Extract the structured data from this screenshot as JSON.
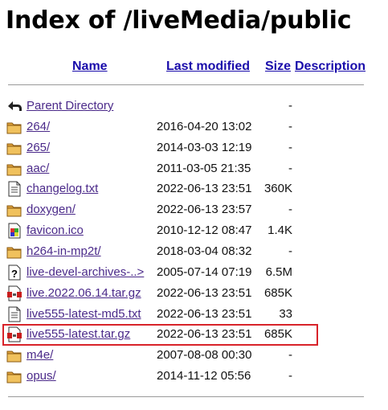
{
  "page": {
    "title": "Index of /liveMedia/public"
  },
  "columns": {
    "name": "Name",
    "last_modified": "Last modified",
    "size": "Size",
    "description": "Description"
  },
  "rows": [
    {
      "name": "Parent Directory",
      "date": "",
      "size": "-",
      "icon": "parent-directory-icon"
    },
    {
      "name": "264/",
      "date": "2016-04-20 13:02",
      "size": "-",
      "icon": "folder-icon"
    },
    {
      "name": "265/",
      "date": "2014-03-03 12:19",
      "size": "-",
      "icon": "folder-icon"
    },
    {
      "name": "aac/",
      "date": "2011-03-05 21:35",
      "size": "-",
      "icon": "folder-icon"
    },
    {
      "name": "changelog.txt",
      "date": "2022-06-13 23:51",
      "size": "360K",
      "icon": "text-file-icon"
    },
    {
      "name": "doxygen/",
      "date": "2022-06-13 23:57",
      "size": "-",
      "icon": "folder-icon"
    },
    {
      "name": "favicon.ico",
      "date": "2010-12-12 08:47",
      "size": "1.4K",
      "icon": "image-file-icon"
    },
    {
      "name": "h264-in-mp2t/",
      "date": "2018-03-04 08:32",
      "size": "-",
      "icon": "folder-icon"
    },
    {
      "name": "live-devel-archives-..>",
      "date": "2005-07-14 07:19",
      "size": "6.5M",
      "icon": "unknown-file-icon"
    },
    {
      "name": "live.2022.06.14.tar.gz",
      "date": "2022-06-13 23:51",
      "size": "685K",
      "icon": "archive-file-icon"
    },
    {
      "name": "live555-latest-md5.txt",
      "date": "2022-06-13 23:51",
      "size": "33",
      "icon": "text-file-icon"
    },
    {
      "name": "live555-latest.tar.gz",
      "date": "2022-06-13 23:51",
      "size": "685K",
      "icon": "archive-file-icon"
    },
    {
      "name": "m4e/",
      "date": "2007-08-08 00:30",
      "size": "-",
      "icon": "folder-icon"
    },
    {
      "name": "opus/",
      "date": "2014-11-12 05:56",
      "size": "-",
      "icon": "folder-icon"
    }
  ],
  "highlight": {
    "row_index": 11,
    "color": "#d8232a"
  }
}
